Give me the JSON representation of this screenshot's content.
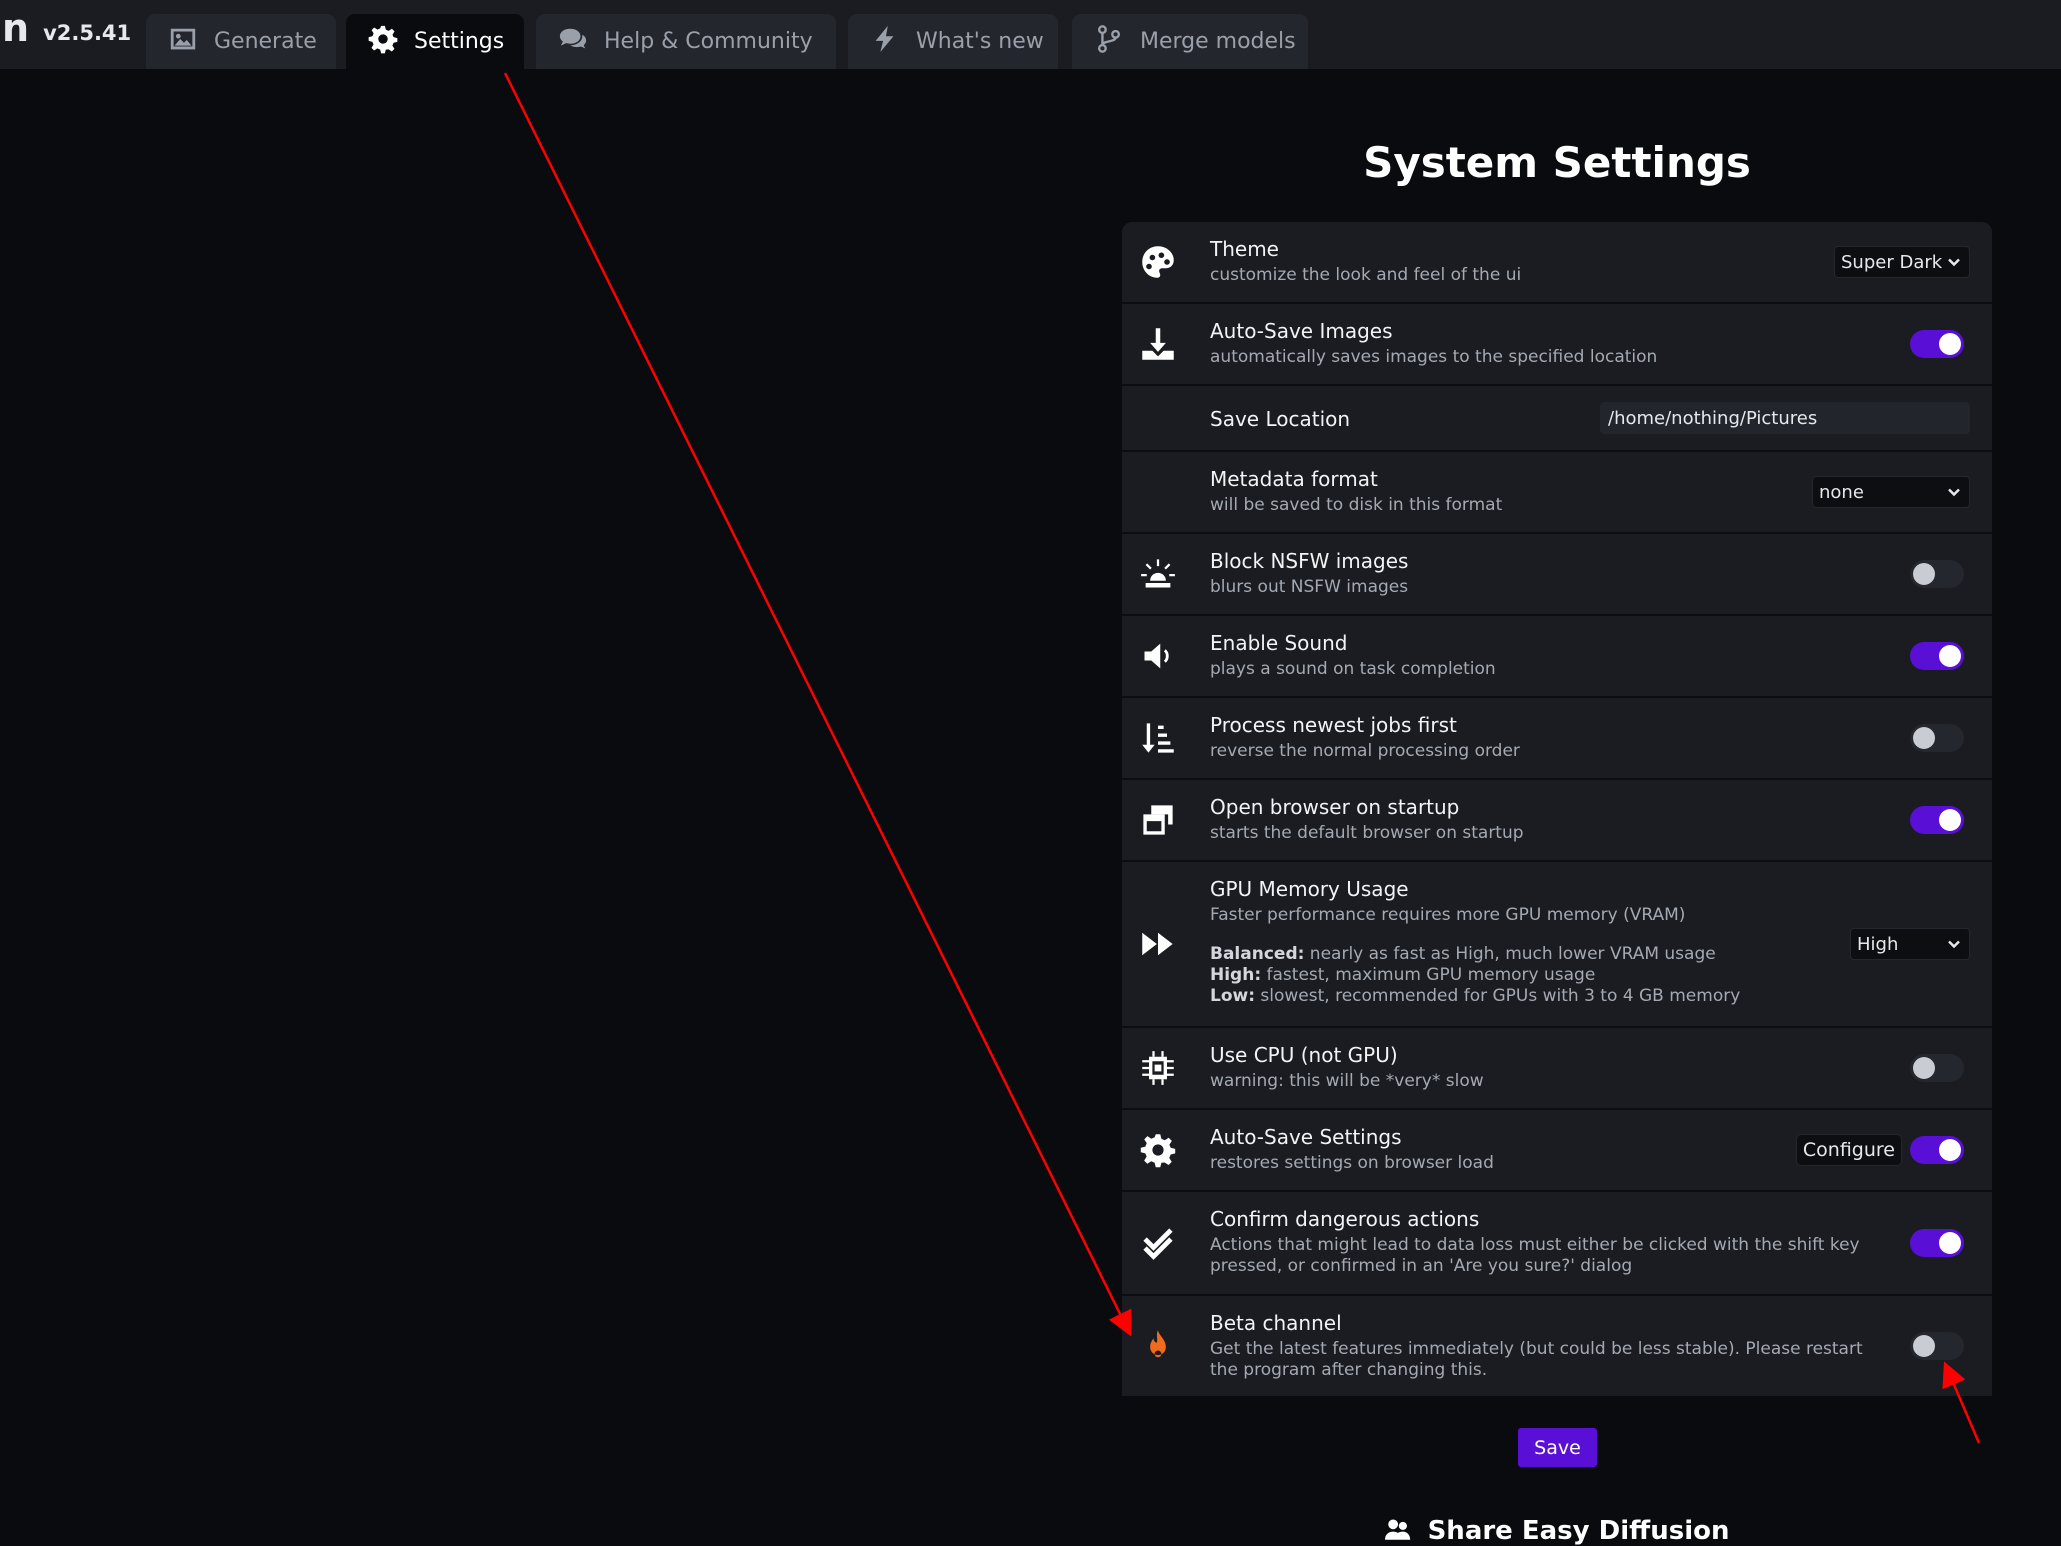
{
  "app": {
    "logo": "n",
    "version": "v2.5.41"
  },
  "tabs": [
    {
      "label": "Generate",
      "icon": "image-icon"
    },
    {
      "label": "Settings",
      "icon": "gear-icon"
    },
    {
      "label": "Help & Community",
      "icon": "comments-icon"
    },
    {
      "label": "What's new",
      "icon": "bolt-icon"
    },
    {
      "label": "Merge models",
      "icon": "code-branch-icon"
    }
  ],
  "active_tab": "Settings",
  "settings": {
    "title": "System Settings",
    "rows": [
      {
        "label": "Theme",
        "desc": "customize the look and feel of the ui",
        "icon": "palette-icon",
        "control": "select",
        "value": "Super Dark"
      },
      {
        "label": "Auto-Save Images",
        "desc": "automatically saves images to the specified location",
        "icon": "download-icon",
        "control": "toggle",
        "value": true
      },
      {
        "label": "Save Location",
        "icon": "",
        "control": "text",
        "value": "/home/nothing/Pictures"
      },
      {
        "label": "Metadata format",
        "desc": "will be saved to disk in this format",
        "icon": "",
        "control": "select",
        "value": "none"
      },
      {
        "label": "Block NSFW images",
        "desc": "blurs out NSFW images",
        "icon": "siren-icon",
        "control": "toggle",
        "value": false
      },
      {
        "label": "Enable Sound",
        "desc": "plays a sound on task completion",
        "icon": "volume-icon",
        "control": "toggle",
        "value": true
      },
      {
        "label": "Process newest jobs first",
        "desc": "reverse the normal processing order",
        "icon": "sort-icon",
        "control": "toggle",
        "value": false
      },
      {
        "label": "Open browser on startup",
        "desc": "starts the default browser on startup",
        "icon": "window-restore-icon",
        "control": "toggle",
        "value": true
      },
      {
        "label": "GPU Memory Usage",
        "desc": "Faster performance requires more GPU memory (VRAM)",
        "icon": "fast-forward-icon",
        "control": "select",
        "value": "High",
        "notes": [
          {
            "term": "Balanced:",
            "text": " nearly as fast as High, much lower VRAM usage"
          },
          {
            "term": "High:",
            "text": " fastest, maximum GPU memory usage"
          },
          {
            "term": "Low:",
            "text": " slowest, recommended for GPUs with 3 to 4 GB memory"
          }
        ]
      },
      {
        "label": "Use CPU (not GPU)",
        "desc": "warning: this will be *very* slow",
        "icon": "microchip-icon",
        "control": "toggle",
        "value": false
      },
      {
        "label": "Auto-Save Settings",
        "desc": "restores settings on browser load",
        "icon": "gear-icon",
        "control": "toggle",
        "value": true,
        "button": "Configure"
      },
      {
        "label": "Confirm dangerous actions",
        "desc": "Actions that might lead to data loss must either be clicked with the shift key pressed, or confirmed in an 'Are you sure?' dialog",
        "icon": "check-double-icon",
        "control": "toggle",
        "value": true
      },
      {
        "label": "Beta channel",
        "desc": "Get the latest features immediately (but could be less stable). Please restart the program after changing this.",
        "icon": "fire-icon",
        "control": "toggle",
        "value": false
      }
    ],
    "save_label": "Save"
  },
  "share": {
    "title": "Share Easy Diffusion",
    "icon": "users-icon"
  },
  "colors": {
    "accent": "#5a0fd6",
    "panel": "#1a1c22",
    "background": "#090b0f",
    "fire": "#f26a1b",
    "annotation": "#ff0000"
  }
}
